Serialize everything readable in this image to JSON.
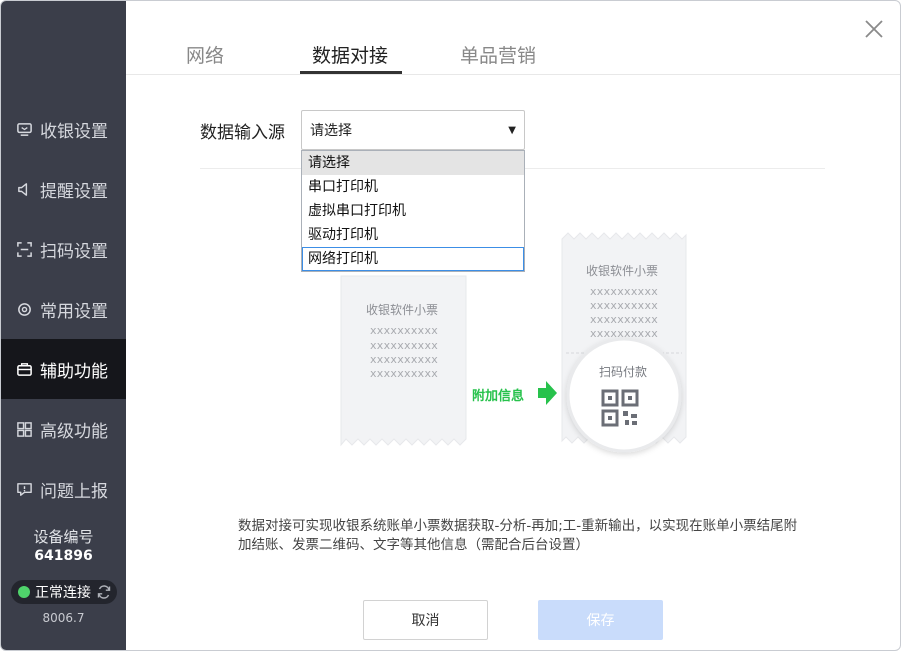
{
  "sidebar": {
    "items": [
      {
        "label": "收银设置",
        "icon": "cashier-icon"
      },
      {
        "label": "提醒设置",
        "icon": "speaker-icon"
      },
      {
        "label": "扫码设置",
        "icon": "scan-icon"
      },
      {
        "label": "常用设置",
        "icon": "gear-icon"
      },
      {
        "label": "辅助功能",
        "icon": "toolbox-icon",
        "active": true
      },
      {
        "label": "高级功能",
        "icon": "grid-icon"
      },
      {
        "label": "问题上报",
        "icon": "report-icon"
      }
    ],
    "device_label": "设备编号",
    "device_number": "641896",
    "connection_status": "正常连接",
    "version": "8006.7"
  },
  "tabs": [
    {
      "label": "网络"
    },
    {
      "label": "数据对接",
      "active": true
    },
    {
      "label": "单品营销"
    }
  ],
  "form": {
    "source_label": "数据输入源",
    "select_value": "请选择",
    "options": [
      "请选择",
      "串口打印机",
      "虚拟串口打印机",
      "驱动打印机",
      "网络打印机"
    ]
  },
  "illustration": {
    "receipt_title": "收银软件小票",
    "receipt_line": "xxxxxxxxxx",
    "arrow_label": "附加信息",
    "qr_label": "扫码付款"
  },
  "description": "数据对接可实现收银系统账单小票数据获取-分析-再加;工-重新输出，以实现在账单小票结尾附加结账、发票二维码、文字等其他信息（需配合后台设置）",
  "buttons": {
    "cancel": "取消",
    "save": "保存"
  },
  "colors": {
    "sidebar_bg": "#3b3e4a",
    "sidebar_active_bg": "#15161b",
    "status_green": "#4fd36b",
    "arrow_green": "#27c24c",
    "save_disabled": "#c9dcfb"
  }
}
